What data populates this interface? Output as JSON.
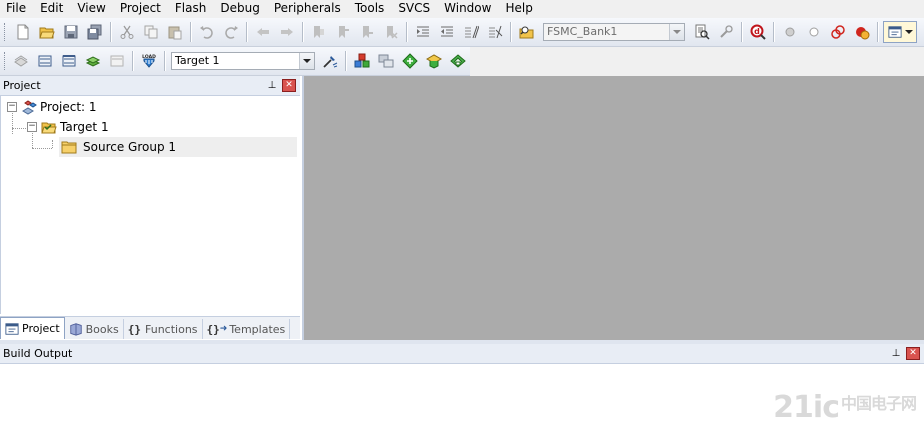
{
  "menu": [
    "File",
    "Edit",
    "View",
    "Project",
    "Flash",
    "Debug",
    "Peripherals",
    "Tools",
    "SVCS",
    "Window",
    "Help"
  ],
  "toolbar1": {
    "icons": [
      "new-file-icon",
      "open-folder-icon",
      "save-icon",
      "save-all-icon",
      "cut-icon",
      "copy-icon",
      "paste-icon",
      "undo-icon",
      "redo-icon",
      "nav-back-icon",
      "nav-forward-icon",
      "bookmark-icon",
      "bookmark-prev-icon",
      "bookmark-next-icon",
      "bookmark-clear-icon",
      "indent-icon",
      "unindent-icon",
      "comment-icon",
      "uncomment-icon",
      "find-in-files-icon"
    ],
    "find_combo_value": "FSMC_Bank1",
    "icons_after": [
      "find-icon",
      "incremental-find-icon",
      "debug-session-icon",
      "breakpoint-icon",
      "breakpoint-disable-icon",
      "breakpoint-kill-icon",
      "breakpoint-kill-all-icon",
      "window-layout-icon"
    ]
  },
  "toolbar2": {
    "target_combo_value": "Target 1"
  },
  "project_pane": {
    "title": "Project",
    "pin_glyph": "⊥",
    "tree": {
      "project": "Project: 1",
      "target": "Target 1",
      "group": "Source Group 1"
    },
    "tabs": [
      {
        "label": "Project"
      },
      {
        "label": "Books"
      },
      {
        "label": "Functions",
        "prefix": "{}"
      },
      {
        "label": "Templates",
        "prefix": "{}"
      }
    ]
  },
  "build_output": {
    "title": "Build Output"
  },
  "watermark": {
    "main": "21ic",
    "sub": "中国电子网"
  }
}
